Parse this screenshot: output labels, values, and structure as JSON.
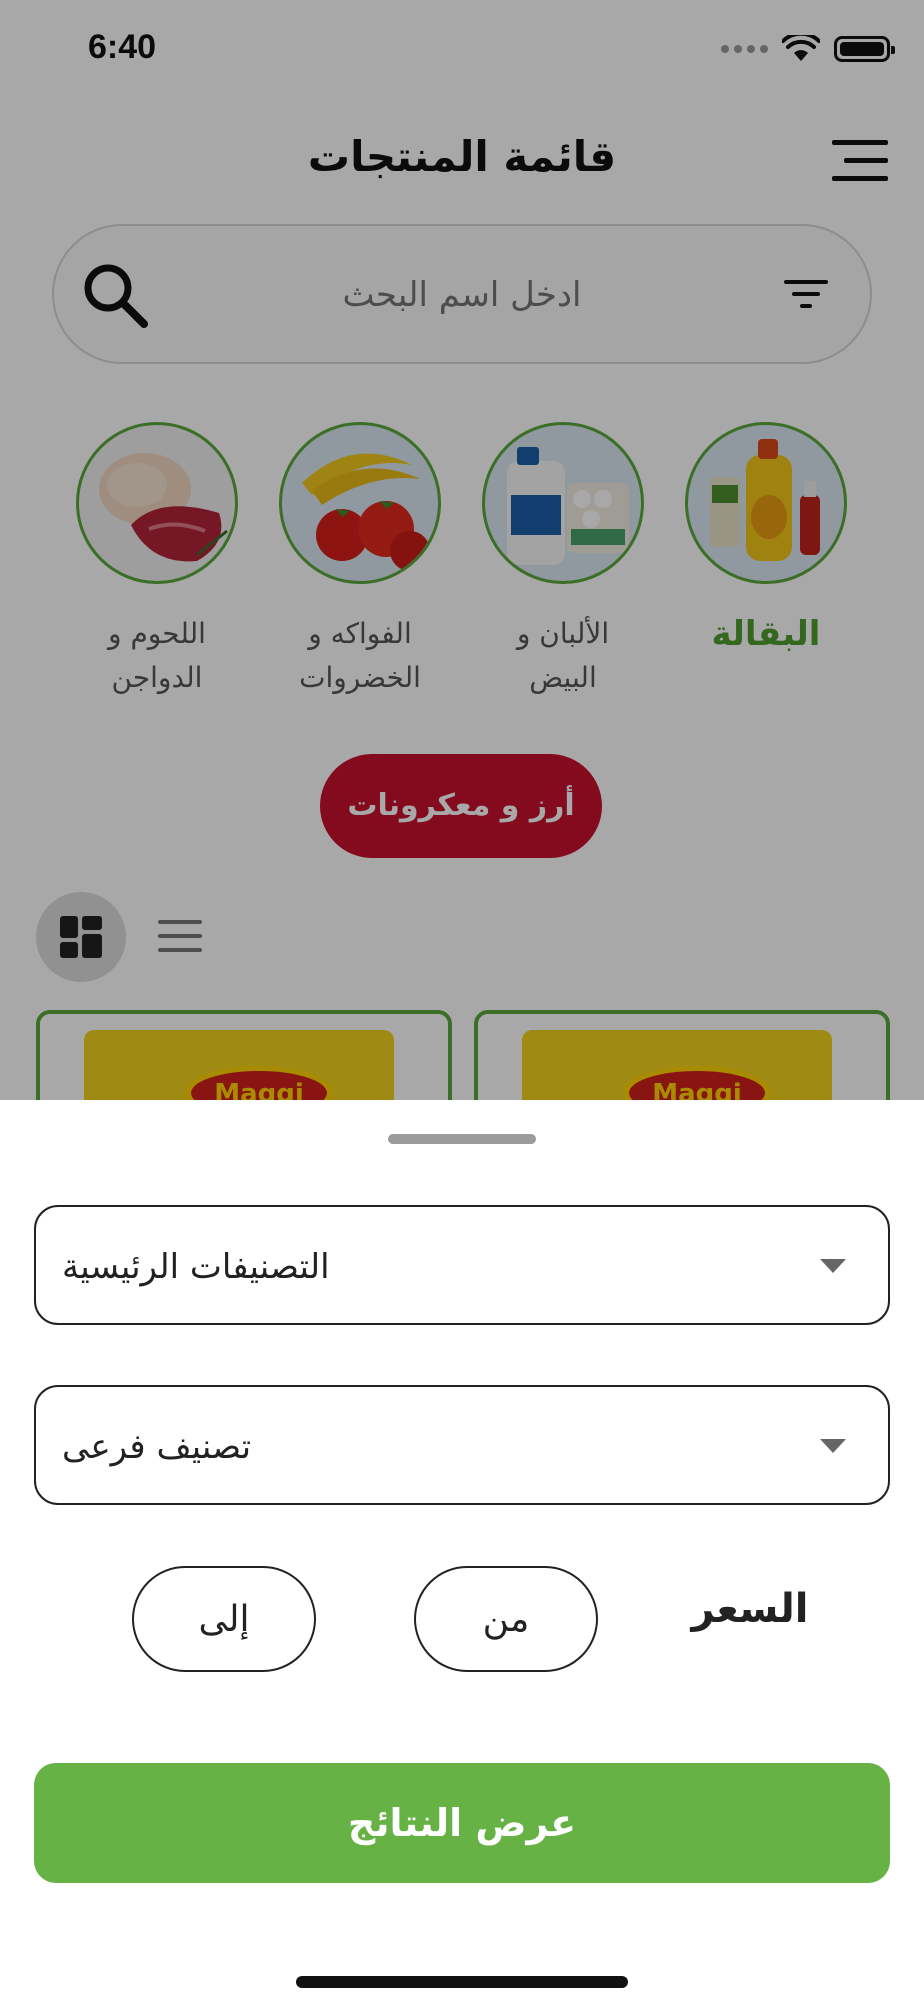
{
  "status_bar": {
    "time": "6:40"
  },
  "header": {
    "title": "قائمة المنتجات"
  },
  "search": {
    "placeholder": "ادخل اسم البحث"
  },
  "categories": [
    {
      "label": "البقالة",
      "active": true
    },
    {
      "label": "الألبان و البيض",
      "active": false
    },
    {
      "label": "الفواكه و الخضروات",
      "active": false
    },
    {
      "label": "اللحوم و الدواجن",
      "active": false
    }
  ],
  "subcategory_chip": "أرز و معكرونات",
  "products": [
    {
      "brand": "Maggi"
    },
    {
      "brand": "Maggi"
    }
  ],
  "filter_sheet": {
    "main_category_value": "التصنيفات الرئيسية",
    "sub_category_value": "تصنيف فرعى",
    "price_label": "السعر",
    "price_from_placeholder": "من",
    "price_to_placeholder": "إلى",
    "submit_label": "عرض النتائج"
  },
  "colors": {
    "brand_green": "#66b245",
    "accent_red": "#c8102e",
    "category_border": "#5aa83a"
  }
}
